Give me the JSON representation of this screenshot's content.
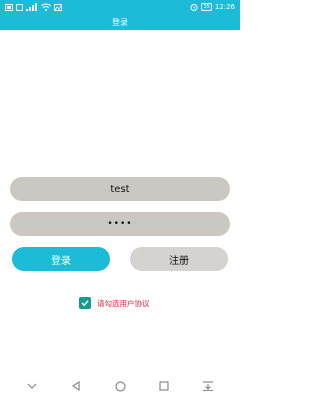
{
  "status_bar": {
    "left_icons": [
      "sim-icon",
      "notification-icon",
      "signal-icon",
      "wifi-icon",
      "image-icon"
    ],
    "battery": "35",
    "time": "12:26",
    "right_icons": [
      "alarm-icon",
      "battery-icon"
    ]
  },
  "header": {
    "title": "登录"
  },
  "form": {
    "username_value": "test",
    "password_value": "••••"
  },
  "buttons": {
    "login_label": "登录",
    "register_label": "注册"
  },
  "agreement": {
    "checked": true,
    "label": "请勾选用户协议"
  },
  "navigation": {
    "buttons": [
      "collapse-icon",
      "back-icon",
      "home-icon",
      "recents-icon",
      "notification-drawer-icon"
    ]
  },
  "colors": {
    "accent": "#1cbcd8",
    "field_background": "#c9c8c2",
    "checkbox": "#159c8c",
    "agreement_text": "#e0243c"
  }
}
